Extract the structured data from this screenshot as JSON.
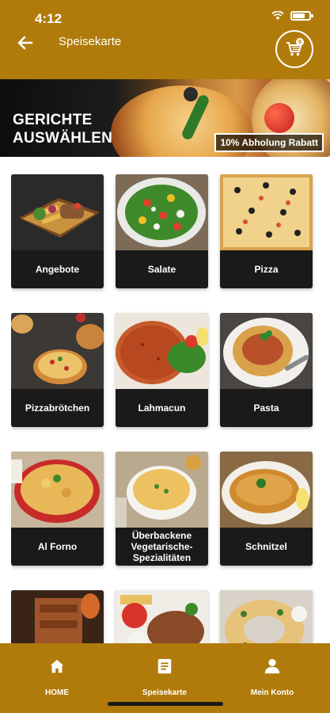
{
  "status_bar": {
    "time": "4:12"
  },
  "header": {
    "title": "Speisekarte",
    "cart_count": "0"
  },
  "banner": {
    "title_line1": "GERICHTE",
    "title_line2": "AUSWÄHLEN",
    "discount": "10% Abholung Rabatt"
  },
  "categories": [
    {
      "label": "Angebote"
    },
    {
      "label": "Salate"
    },
    {
      "label": "Pizza"
    },
    {
      "label": "Pizzabrötchen"
    },
    {
      "label": "Lahmacun"
    },
    {
      "label": "Pasta"
    },
    {
      "label": "Al Forno"
    },
    {
      "label": "Überbackene Vegetarische-Spezialitäten"
    },
    {
      "label": "Schnitzel"
    },
    {
      "label": ""
    },
    {
      "label": ""
    },
    {
      "label": ""
    }
  ],
  "bottom_nav": [
    {
      "label": "HOME",
      "icon": "home-icon"
    },
    {
      "label": "Speisekarte",
      "icon": "menu-icon"
    },
    {
      "label": "Mein Konto",
      "icon": "account-icon"
    }
  ],
  "colors": {
    "brand": "#b07b0a",
    "card": "#1a1a1a"
  }
}
